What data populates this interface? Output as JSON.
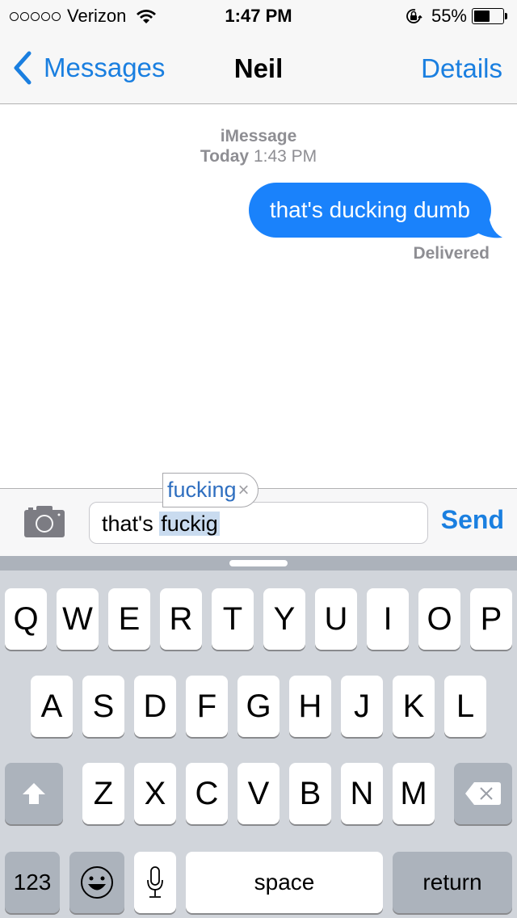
{
  "status_bar": {
    "signal_dots": 5,
    "carrier": "Verizon",
    "time": "1:47 PM",
    "battery_percent_label": "55%",
    "battery_level": 0.55
  },
  "nav": {
    "back_label": "Messages",
    "title": "Neil",
    "details_label": "Details"
  },
  "thread": {
    "service": "iMessage",
    "day": "Today",
    "time": "1:43 PM",
    "messages": [
      {
        "text": "that's ducking dumb",
        "sender": "me",
        "status": "Delivered"
      }
    ]
  },
  "compose": {
    "text_plain": "that's ",
    "text_selected": "fuckig",
    "send_label": "Send",
    "autocorrect_suggestion": "fucking",
    "autocorrect_dismiss": "×"
  },
  "keyboard": {
    "row1": [
      "Q",
      "W",
      "E",
      "R",
      "T",
      "Y",
      "U",
      "I",
      "O",
      "P"
    ],
    "row2": [
      "A",
      "S",
      "D",
      "F",
      "G",
      "H",
      "J",
      "K",
      "L"
    ],
    "row3": [
      "Z",
      "X",
      "C",
      "V",
      "B",
      "N",
      "M"
    ],
    "numbers_label": "123",
    "space_label": "space",
    "return_label": "return"
  },
  "colors": {
    "accent": "#1a7fe0",
    "bubble": "#1a82fb",
    "selection": "#c9dbef",
    "keyboard_bg": "#d1d5db"
  }
}
